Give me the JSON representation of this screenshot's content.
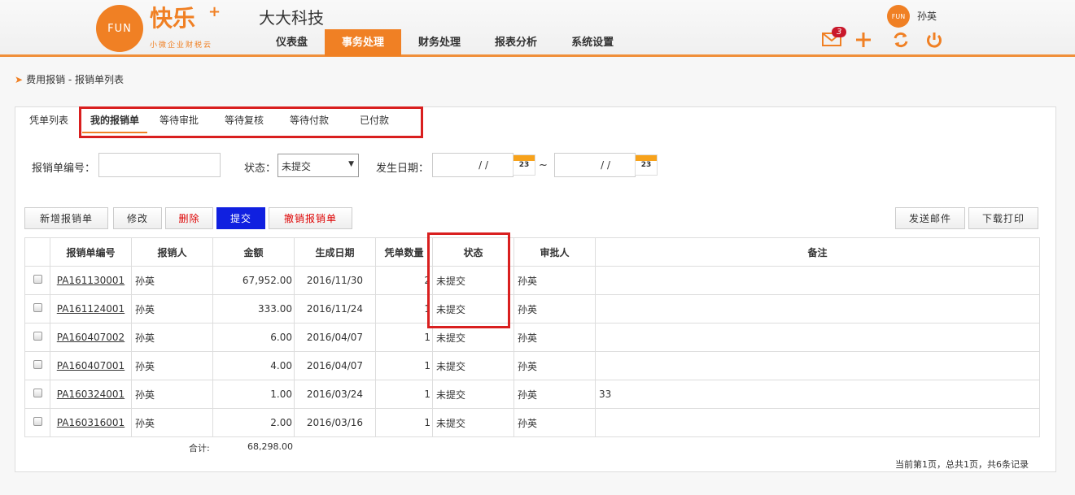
{
  "header": {
    "logo_circle_text": "FUN",
    "logo_text": "快乐",
    "logo_plus": "+",
    "logo_sub": "小微企业财税云",
    "company": "大大科技",
    "nav": [
      "仪表盘",
      "事务处理",
      "财务处理",
      "报表分析",
      "系统设置"
    ],
    "nav_active": "事务处理",
    "user_avatar_text": "FUN",
    "user_name": "孙英",
    "mail_badge": "3",
    "icons": [
      "mail-icon",
      "plus-icon",
      "refresh-icon",
      "power-icon"
    ],
    "accent": "#f08024"
  },
  "breadcrumb": "费用报销 - 报销单列表",
  "tabs": {
    "list_label": "凭单列表",
    "items": [
      "我的报销单",
      "等待审批",
      "等待复核",
      "等待付款",
      "已付款"
    ]
  },
  "filters": {
    "number_label": "报销单编号：",
    "status_label": "状态：",
    "status_value": "未提交",
    "date_label": "发生日期：",
    "date_placeholder": "/ /",
    "date_sep": "~",
    "calendar_day": "23"
  },
  "buttons": {
    "add": "新增报销单",
    "edit": "修改",
    "delete": "删除",
    "submit": "提交",
    "revoke": "撤销报销单",
    "email": "发送邮件",
    "download": "下载打印"
  },
  "table": {
    "headers": [
      "报销单编号",
      "报销人",
      "金额",
      "生成日期",
      "凭单数量",
      "状态",
      "审批人",
      "备注"
    ],
    "rows": [
      {
        "id": "PA161130001",
        "person": "孙英",
        "amount": "67,952.00",
        "date": "2016/11/30",
        "count": "2",
        "status": "未提交",
        "approver": "孙英",
        "note": ""
      },
      {
        "id": "PA161124001",
        "person": "孙英",
        "amount": "333.00",
        "date": "2016/11/24",
        "count": "1",
        "status": "未提交",
        "approver": "孙英",
        "note": ""
      },
      {
        "id": "PA160407002",
        "person": "孙英",
        "amount": "6.00",
        "date": "2016/04/07",
        "count": "1",
        "status": "未提交",
        "approver": "孙英",
        "note": ""
      },
      {
        "id": "PA160407001",
        "person": "孙英",
        "amount": "4.00",
        "date": "2016/04/07",
        "count": "1",
        "status": "未提交",
        "approver": "孙英",
        "note": ""
      },
      {
        "id": "PA160324001",
        "person": "孙英",
        "amount": "1.00",
        "date": "2016/03/24",
        "count": "1",
        "status": "未提交",
        "approver": "孙英",
        "note": "33"
      },
      {
        "id": "PA160316001",
        "person": "孙英",
        "amount": "2.00",
        "date": "2016/03/16",
        "count": "1",
        "status": "未提交",
        "approver": "孙英",
        "note": ""
      }
    ],
    "total_label": "合计:",
    "total_value": "68,298.00"
  },
  "pager": "当前第1页，总共1页，共6条记录"
}
